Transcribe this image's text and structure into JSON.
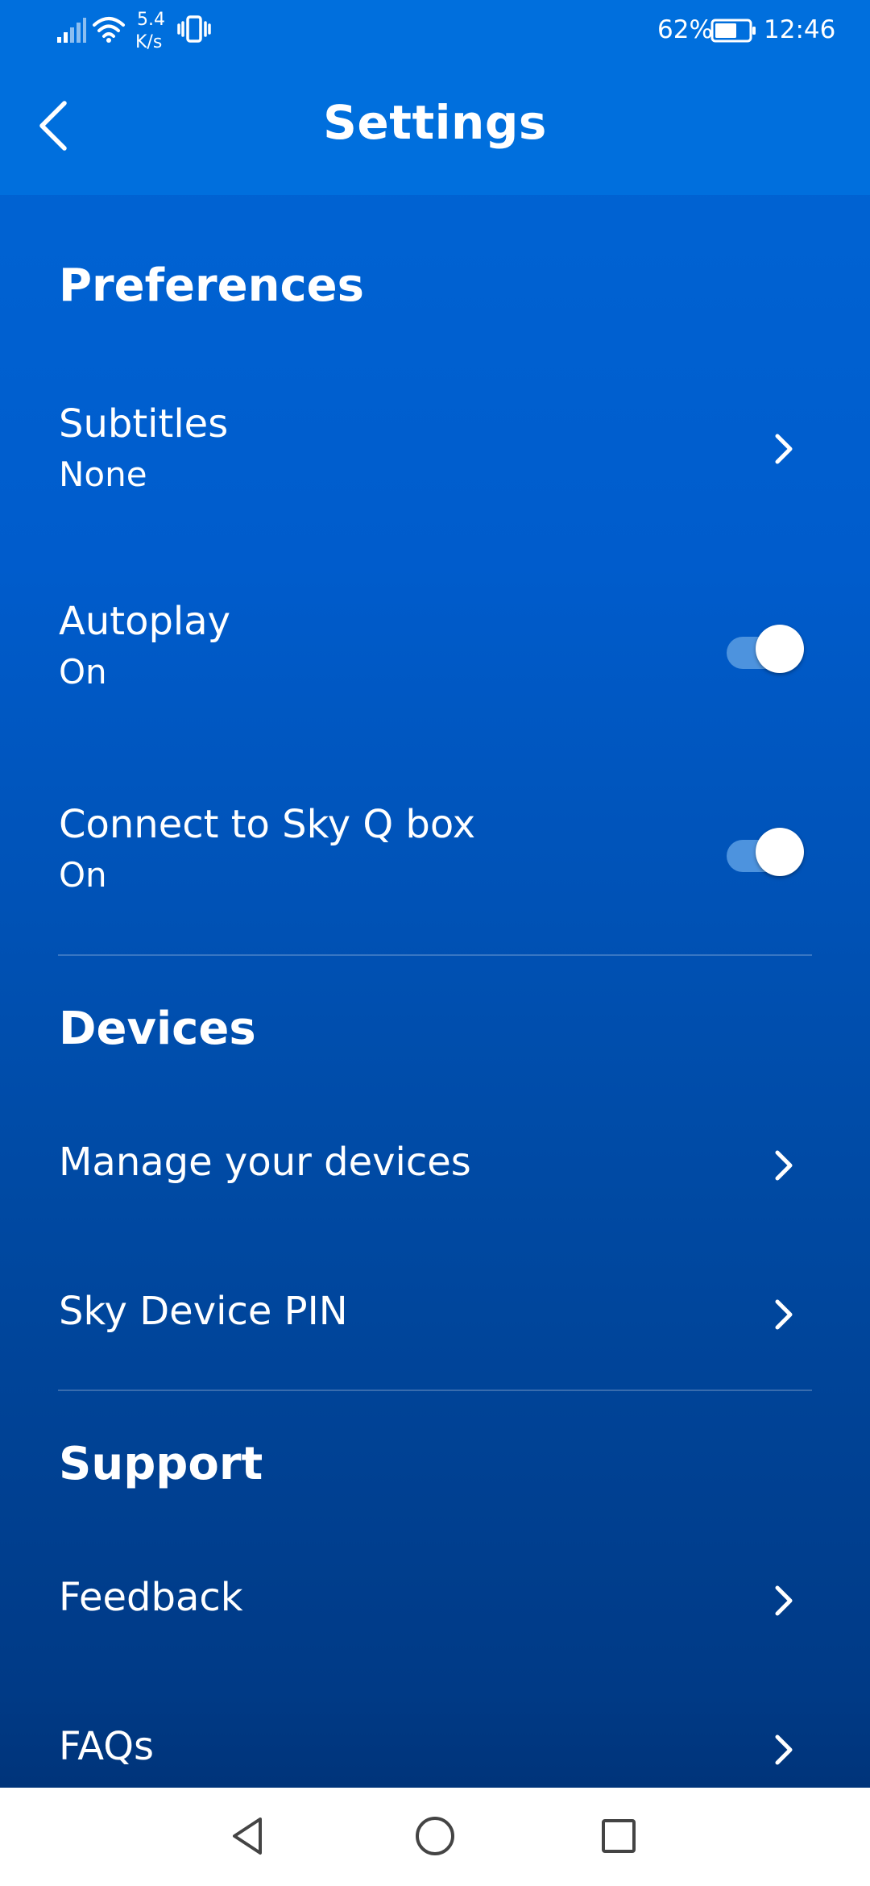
{
  "status_bar": {
    "network_speed_value": "5.4",
    "network_speed_unit": "K/s",
    "battery_percent": "62%",
    "time": "12:46",
    "icons": [
      "signal-icon",
      "wifi-icon",
      "vibrate-icon",
      "battery-icon"
    ]
  },
  "header": {
    "title": "Settings",
    "back_icon": "chevron-left-icon"
  },
  "sections": {
    "preferences": {
      "title": "Preferences",
      "subtitles": {
        "label": "Subtitles",
        "value": "None"
      },
      "autoplay": {
        "label": "Autoplay",
        "value": "On",
        "enabled": true
      },
      "sky_q": {
        "label": "Connect to Sky Q box",
        "value": "On",
        "enabled": true
      }
    },
    "devices": {
      "title": "Devices",
      "manage": {
        "label": "Manage your devices"
      },
      "pin": {
        "label": "Sky Device PIN"
      }
    },
    "support": {
      "title": "Support",
      "feedback": {
        "label": "Feedback"
      },
      "faqs": {
        "label": "FAQs"
      }
    }
  },
  "nav_bar": {
    "icons": [
      "back-triangle-icon",
      "home-circle-icon",
      "recents-square-icon"
    ]
  },
  "colors": {
    "header_bg": "#006fdd",
    "content_top": "#0066d6",
    "content_bottom": "#00347a",
    "toggle_track": "#4d93de",
    "nav_bg": "#ffffff"
  }
}
